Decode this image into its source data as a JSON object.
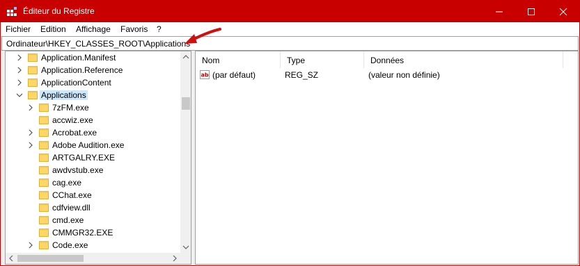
{
  "window": {
    "title": "Éditeur du Registre",
    "accent_color": "#c80000"
  },
  "titlebar_buttons": {
    "minimize": "minimize-icon",
    "maximize": "maximize-icon",
    "close": "close-icon"
  },
  "menu": {
    "items": [
      "Fichier",
      "Edition",
      "Affichage",
      "Favoris",
      "?"
    ]
  },
  "address": {
    "path": "Ordinateur\\HKEY_CLASSES_ROOT\\Applications"
  },
  "tree": {
    "items": [
      {
        "label": "Application.Manifest",
        "expander": "chevron-right-icon"
      },
      {
        "label": "Application.Reference",
        "expander": "chevron-right-icon"
      },
      {
        "label": "ApplicationContent",
        "expander": "chevron-right-icon"
      },
      {
        "label": "Applications",
        "expander": "chevron-down-icon",
        "selected": true
      },
      {
        "label": "7zFM.exe",
        "expander": "chevron-right-icon"
      },
      {
        "label": "accwiz.exe",
        "expander": ""
      },
      {
        "label": "Acrobat.exe",
        "expander": "chevron-right-icon"
      },
      {
        "label": "Adobe Audition.exe",
        "expander": "chevron-right-icon"
      },
      {
        "label": "ARTGALRY.EXE",
        "expander": ""
      },
      {
        "label": "awdvstub.exe",
        "expander": ""
      },
      {
        "label": "cag.exe",
        "expander": ""
      },
      {
        "label": "CChat.exe",
        "expander": ""
      },
      {
        "label": "cdfview.dll",
        "expander": ""
      },
      {
        "label": "cmd.exe",
        "expander": ""
      },
      {
        "label": "CMMGR32.EXE",
        "expander": ""
      },
      {
        "label": "Code.exe",
        "expander": "chevron-right-icon"
      }
    ]
  },
  "values": {
    "columns": [
      "Nom",
      "Type",
      "Données"
    ],
    "rows": [
      {
        "name": "(par défaut)",
        "type": "REG_SZ",
        "data": "(valeur non définie)",
        "icon": "string-value-icon"
      }
    ]
  }
}
